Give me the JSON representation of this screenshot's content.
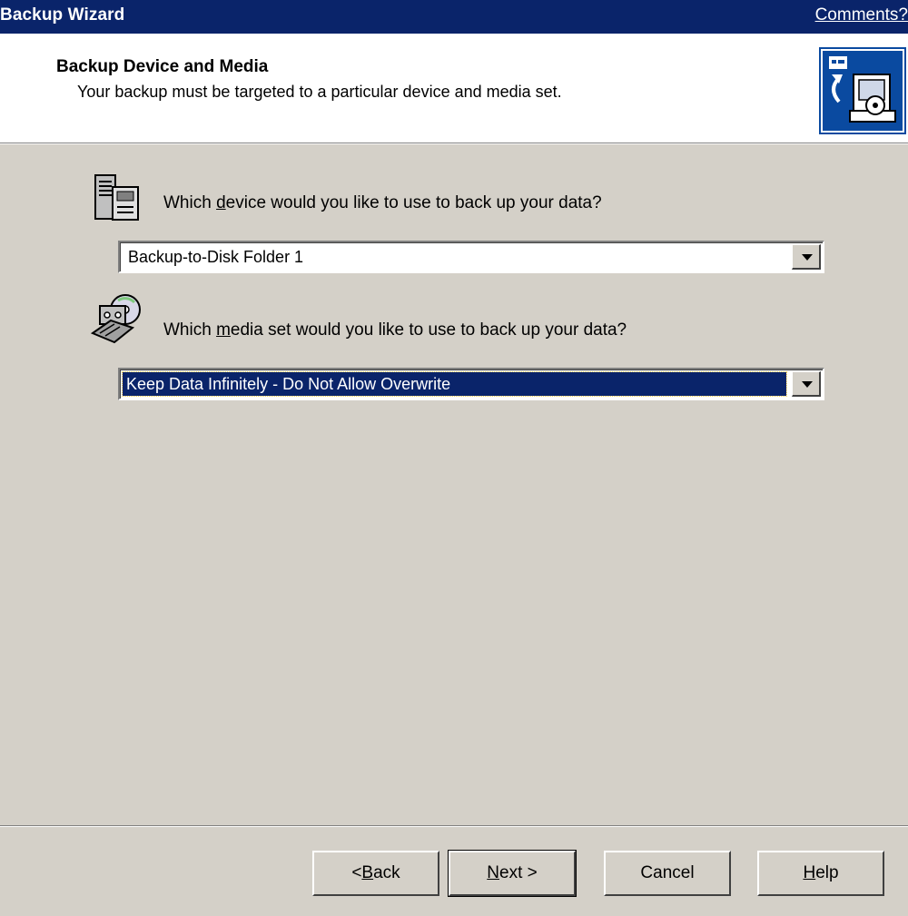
{
  "window": {
    "title": "Backup Wizard",
    "comments_link": "Comments?"
  },
  "header": {
    "title": "Backup Device and Media",
    "subtitle": "Your backup must be targeted to a particular device and media set.",
    "icon": "backup-wizard-icon"
  },
  "device": {
    "icon": "server-device-icon",
    "label_pre": "Which ",
    "label_accel": "d",
    "label_post": "evice would you like to use to back up your data?",
    "selected": "Backup-to-Disk Folder 1"
  },
  "media": {
    "icon": "media-set-icon",
    "label_pre": "Which ",
    "label_accel": "m",
    "label_post": "edia set would you like to use to back up your data?",
    "selected": "Keep Data Infinitely - Do Not Allow Overwrite"
  },
  "buttons": {
    "back_pre": "< ",
    "back_accel": "B",
    "back_post": "ack",
    "next_accel": "N",
    "next_post": "ext >",
    "cancel": "Cancel",
    "help_accel": "H",
    "help_post": "elp"
  },
  "colors": {
    "titlebar": "#0a246a",
    "dialog_bg": "#d4d0c8",
    "selection": "#0a246a"
  }
}
